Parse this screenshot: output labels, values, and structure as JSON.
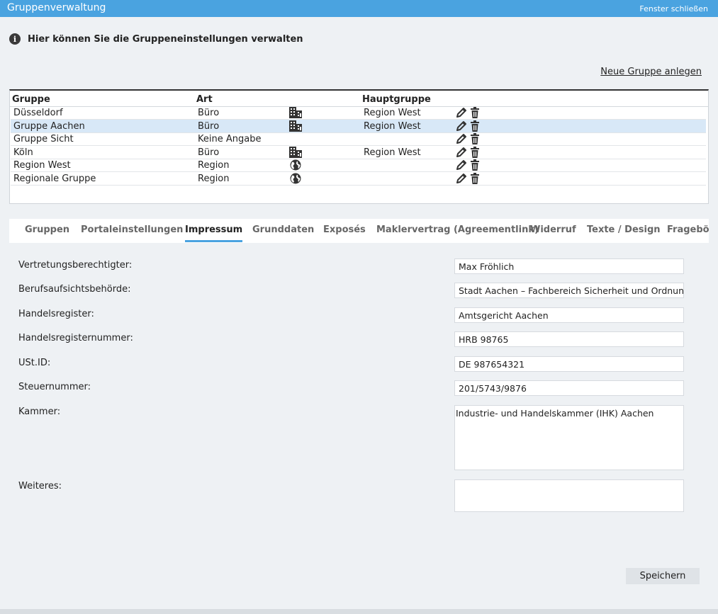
{
  "window": {
    "title": "Gruppenverwaltung",
    "close_label": "Fenster schließen"
  },
  "info": {
    "icon": "info-icon",
    "text": "Hier können Sie die Gruppeneinstellungen verwalten"
  },
  "new_group_link": "Neue Gruppe anlegen",
  "table": {
    "headers": {
      "group": "Gruppe",
      "type": "Art",
      "parent": "Hauptgruppe"
    },
    "rows": [
      {
        "name": "Düsseldorf",
        "type": "Büro",
        "type_icon": "office-building-icon",
        "parent": "Region West"
      },
      {
        "name": "Gruppe Aachen",
        "type": "Büro",
        "type_icon": "office-building-icon",
        "parent": "Region West",
        "selected": true
      },
      {
        "name": "Gruppe Sicht",
        "type": "Keine Angabe",
        "type_icon": "",
        "parent": ""
      },
      {
        "name": "Köln",
        "type": "Büro",
        "type_icon": "office-building-icon",
        "parent": "Region West"
      },
      {
        "name": "Region West",
        "type": "Region",
        "type_icon": "globe-icon",
        "parent": ""
      },
      {
        "name": "Regionale Gruppe",
        "type": "Region",
        "type_icon": "globe-icon",
        "parent": ""
      }
    ]
  },
  "tabs": [
    {
      "label": "Gruppen",
      "active": false
    },
    {
      "label": "Portaleinstellungen",
      "active": false
    },
    {
      "label": "Impressum",
      "active": true
    },
    {
      "label": "Grunddaten",
      "active": false
    },
    {
      "label": "Exposés",
      "active": false
    },
    {
      "label": "Maklervertrag (Agreementlink)",
      "active": false
    },
    {
      "label": "Widerruf",
      "active": false
    },
    {
      "label": "Texte / Design",
      "active": false
    },
    {
      "label": "Fragebögen",
      "active": false
    }
  ],
  "form": {
    "vertretung": {
      "label": "Vertretungsberechtigter:",
      "value": "Max Fröhlich"
    },
    "aufsicht": {
      "label": "Berufsaufsichtsbehörde:",
      "value": "Stadt Aachen – Fachbereich Sicherheit und Ordnung"
    },
    "register": {
      "label": "Handelsregister:",
      "value": "Amtsgericht Aachen"
    },
    "registernummer": {
      "label": "Handelsregisternummer:",
      "value": "HRB 98765"
    },
    "ustid": {
      "label": "USt.ID:",
      "value": "DE 987654321"
    },
    "steuernummer": {
      "label": "Steuernummer:",
      "value": "201/5743/9876"
    },
    "kammer": {
      "label": "Kammer:",
      "value": "Industrie- und Handelskammer (IHK) Aachen"
    },
    "weiteres": {
      "label": "Weiteres:",
      "value": ""
    }
  },
  "save_label": "Speichern",
  "colors": {
    "accent": "#4aa3e0",
    "selected_row": "#d8e8f7",
    "background": "#eef1f4"
  }
}
